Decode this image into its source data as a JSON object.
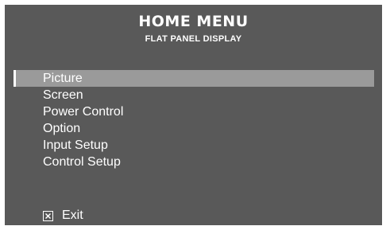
{
  "header": {
    "title": "HOME MENU",
    "subtitle": "FLAT PANEL DISPLAY"
  },
  "menu": {
    "selected_index": 0,
    "items": [
      {
        "label": "Picture"
      },
      {
        "label": "Screen"
      },
      {
        "label": "Power Control"
      },
      {
        "label": "Option"
      },
      {
        "label": "Input Setup"
      },
      {
        "label": "Control Setup"
      }
    ]
  },
  "footer": {
    "exit_label": "Exit",
    "exit_icon": "close-box-icon"
  },
  "colors": {
    "panel_background": "#595959",
    "selection_highlight": "#9a9a9a",
    "text": "#ffffff"
  }
}
